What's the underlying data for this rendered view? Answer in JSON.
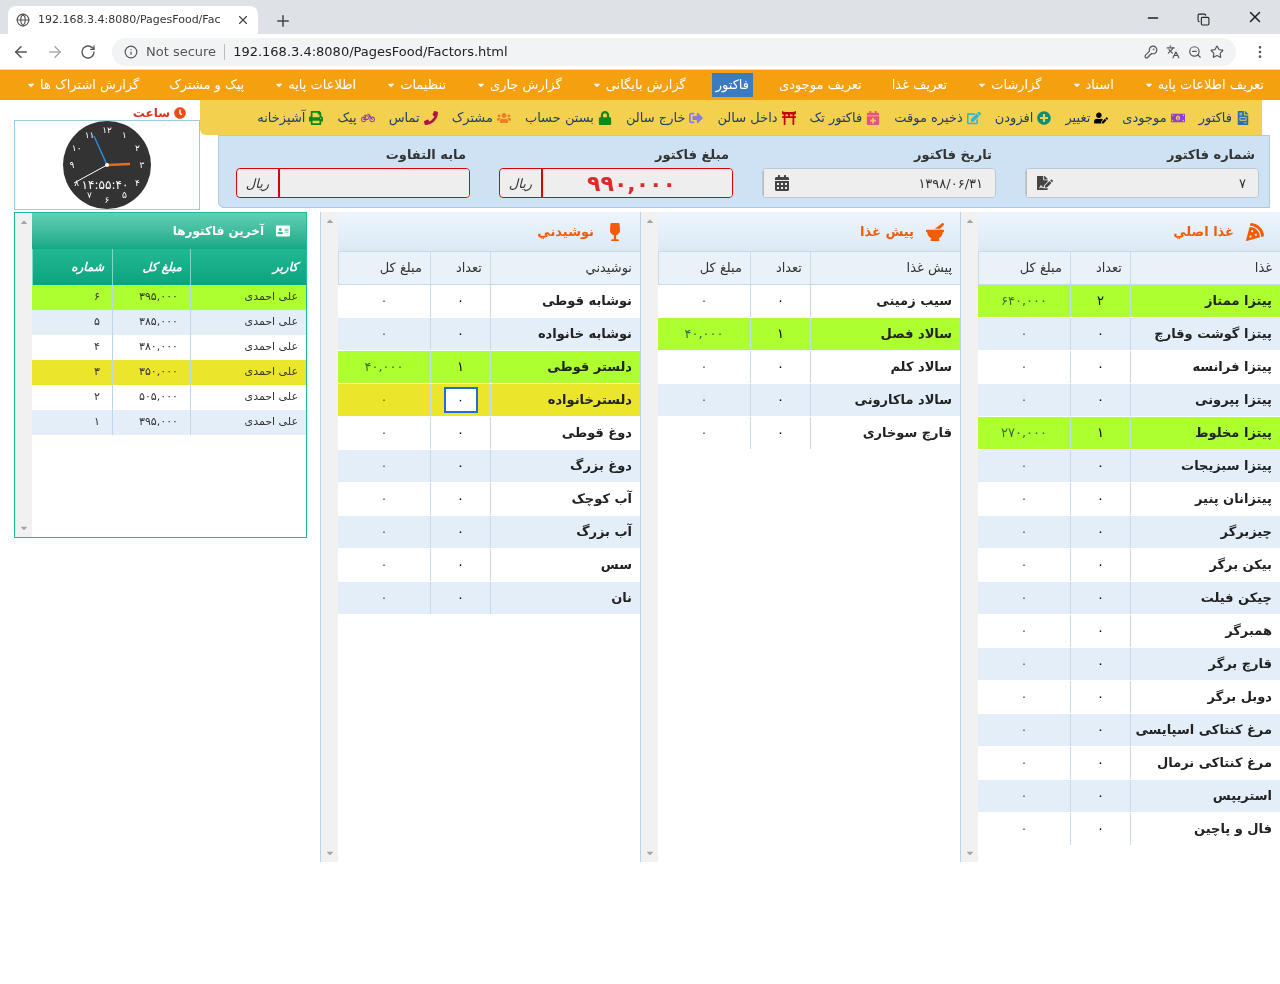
{
  "browser": {
    "tab_title": "192.168.3.4:8080/PagesFood/Fac",
    "security": "Not secure",
    "url": "192.168.3.4:8080/PagesFood/Factors.html"
  },
  "menu": [
    {
      "label": "تعریف اطلاعات پایه",
      "dropdown": true,
      "selected": false
    },
    {
      "label": "اسناد",
      "dropdown": true,
      "selected": false
    },
    {
      "label": "گزارشات",
      "dropdown": true,
      "selected": false
    },
    {
      "label": "تعریف غذا",
      "dropdown": false,
      "selected": false
    },
    {
      "label": "تعریف موجودی",
      "dropdown": false,
      "selected": false
    },
    {
      "label": "فاکتور",
      "dropdown": false,
      "selected": true
    },
    {
      "label": "گزارش بایگانی",
      "dropdown": true,
      "selected": false
    },
    {
      "label": "گزارش جاری",
      "dropdown": true,
      "selected": false
    },
    {
      "label": "تنظیمات",
      "dropdown": true,
      "selected": false
    },
    {
      "label": "اطلاعات پایه",
      "dropdown": true,
      "selected": false
    },
    {
      "label": "پیک و مشترک",
      "dropdown": false,
      "selected": false
    },
    {
      "label": "گزارش اشتراک ها",
      "dropdown": true,
      "selected": false
    }
  ],
  "toolbar": [
    {
      "label": "فاکتور"
    },
    {
      "label": "موجودی"
    },
    {
      "label": "تغییر"
    },
    {
      "label": "افزودن"
    },
    {
      "label": "ذخیره موقت"
    },
    {
      "label": "فاکتور تک"
    },
    {
      "label": "داخل سالن"
    },
    {
      "label": "خارج سالن"
    },
    {
      "label": "بستن حساب"
    },
    {
      "label": "مشترک"
    },
    {
      "label": "تماس"
    },
    {
      "label": "پیک"
    },
    {
      "label": "آشپزخانه"
    }
  ],
  "clock": {
    "label": "ساعت",
    "numerals": [
      "۱۲",
      "۱",
      "۲",
      "۳",
      "۴",
      "۵",
      "۶",
      "۷",
      "۸",
      "۹",
      "۱۰",
      "۱۱"
    ],
    "time": "۱۴:۵۵:۴۰"
  },
  "invoice_form": [
    {
      "label": "شماره فاکتور",
      "value": "۷",
      "kind": "edit"
    },
    {
      "label": "تاریخ فاکتور",
      "value": "۱۳۹۸/۰۶/۳۱",
      "kind": "calendar"
    },
    {
      "label": "مبلغ فاکتور",
      "value": "۹۹۰,۰۰۰",
      "kind": "currency",
      "addon": "ریال"
    },
    {
      "label": "مابه التفاوت",
      "kind": "currency",
      "addon": "ریال"
    }
  ],
  "panels": [
    {
      "title": "غذا اصلي",
      "columns": [
        "غذا",
        "تعداد",
        "مبلغ کل"
      ],
      "rows": [
        {
          "name": "پیتزا ممتاز",
          "count": "۲",
          "total": "۶۴۰,۰۰۰",
          "selected": true,
          "highlighted": false
        },
        {
          "name": "پیتزا گوشت وقارچ",
          "count": "۰",
          "total": "۰",
          "selected": false,
          "highlighted": false
        },
        {
          "name": "پیتزا فرانسه",
          "count": "۰",
          "total": "۰",
          "selected": false,
          "highlighted": false
        },
        {
          "name": "پیتزا پپرونی",
          "count": "۰",
          "total": "۰",
          "selected": false,
          "highlighted": false
        },
        {
          "name": "پیتزا مخلوط",
          "count": "۱",
          "total": "۲۷۰,۰۰۰",
          "selected": true,
          "highlighted": false
        },
        {
          "name": "پیتزا سبزیجات",
          "count": "۰",
          "total": "۰",
          "selected": false,
          "highlighted": false
        },
        {
          "name": "پیتزانان پنیر",
          "count": "۰",
          "total": "۰",
          "selected": false,
          "highlighted": false
        },
        {
          "name": "چیزبرگر",
          "count": "۰",
          "total": "۰",
          "selected": false,
          "highlighted": false
        },
        {
          "name": "بیکن برگر",
          "count": "۰",
          "total": "۰",
          "selected": false,
          "highlighted": false
        },
        {
          "name": "چیکن فیلت",
          "count": "۰",
          "total": "۰",
          "selected": false,
          "highlighted": false
        },
        {
          "name": "همبرگر",
          "count": "۰",
          "total": "۰",
          "selected": false,
          "highlighted": false
        },
        {
          "name": "قارچ برگر",
          "count": "۰",
          "total": "۰",
          "selected": false,
          "highlighted": false
        },
        {
          "name": "دوبل برگر",
          "count": "۰",
          "total": "۰",
          "selected": false,
          "highlighted": false
        },
        {
          "name": "مرغ کنتاکی اسپایسی",
          "count": "۰",
          "total": "۰",
          "selected": false,
          "highlighted": false
        },
        {
          "name": "مرغ کنتاکی نرمال",
          "count": "۰",
          "total": "۰",
          "selected": false,
          "highlighted": false
        },
        {
          "name": "استریپس",
          "count": "۰",
          "total": "۰",
          "selected": false,
          "highlighted": false
        },
        {
          "name": "فال و پاچین",
          "count": "۰",
          "total": "۰",
          "selected": false,
          "highlighted": false
        }
      ]
    },
    {
      "title": "پیش غذا",
      "columns": [
        "پیش غذا",
        "تعداد",
        "مبلغ کل"
      ],
      "rows": [
        {
          "name": "سیب زمینی",
          "count": "۰",
          "total": "۰",
          "selected": false,
          "highlighted": false
        },
        {
          "name": "سالاد فصل",
          "count": "۱",
          "total": "۴۰,۰۰۰",
          "selected": true,
          "highlighted": false
        },
        {
          "name": "سالاد کلم",
          "count": "۰",
          "total": "۰",
          "selected": false,
          "highlighted": false
        },
        {
          "name": "سالاد ماکارونی",
          "count": "۰",
          "total": "۰",
          "selected": false,
          "highlighted": false
        },
        {
          "name": "قارچ سوخاری",
          "count": "۰",
          "total": "۰",
          "selected": false,
          "highlighted": false
        }
      ]
    },
    {
      "title": "نوشيدني",
      "columns": [
        "نوشيدني",
        "تعداد",
        "مبلغ کل"
      ],
      "rows": [
        {
          "name": "نوشابه قوطی",
          "count": "۰",
          "total": "۰",
          "selected": false,
          "highlighted": false
        },
        {
          "name": "نوشابه خانواده",
          "count": "۰",
          "total": "۰",
          "selected": false,
          "highlighted": false
        },
        {
          "name": "دلستر قوطی",
          "count": "۱",
          "total": "۴۰,۰۰۰",
          "selected": true,
          "highlighted": false
        },
        {
          "name": "دلسترخانواده",
          "count": "۰",
          "total": "۰",
          "selected": false,
          "highlighted": true
        },
        {
          "name": "دوغ قوطی",
          "count": "۰",
          "total": "۰",
          "selected": false,
          "highlighted": false
        },
        {
          "name": "دوغ بزرگ",
          "count": "۰",
          "total": "۰",
          "selected": false,
          "highlighted": false
        },
        {
          "name": "آب کوچک",
          "count": "۰",
          "total": "۰",
          "selected": false,
          "highlighted": false
        },
        {
          "name": "آب بزرگ",
          "count": "۰",
          "total": "۰",
          "selected": false,
          "highlighted": false
        },
        {
          "name": "سس",
          "count": "۰",
          "total": "۰",
          "selected": false,
          "highlighted": false
        },
        {
          "name": "نان",
          "count": "۰",
          "total": "۰",
          "selected": false,
          "highlighted": false
        }
      ]
    }
  ],
  "recent_invoices": {
    "title": "آخرین فاکتورها",
    "columns": [
      "کاربر",
      "مبلغ کل",
      "شماره"
    ],
    "rows": [
      {
        "user": "علی احمدی",
        "total": "۳۹۵,۰۰۰",
        "number": "۶",
        "selected": true,
        "highlighted": false
      },
      {
        "user": "علی احمدی",
        "total": "۳۸۵,۰۰۰",
        "number": "۵",
        "selected": false,
        "highlighted": false
      },
      {
        "user": "علی احمدی",
        "total": "۳۸۰,۰۰۰",
        "number": "۴",
        "selected": false,
        "highlighted": false
      },
      {
        "user": "علی احمدی",
        "total": "۳۵۰,۰۰۰",
        "number": "۳",
        "selected": false,
        "highlighted": true
      },
      {
        "user": "علی احمدی",
        "total": "۵۰۵,۰۰۰",
        "number": "۲",
        "selected": false,
        "highlighted": false
      },
      {
        "user": "علی احمدی",
        "total": "۳۹۵,۰۰۰",
        "number": "۱",
        "selected": false,
        "highlighted": false
      }
    ]
  }
}
